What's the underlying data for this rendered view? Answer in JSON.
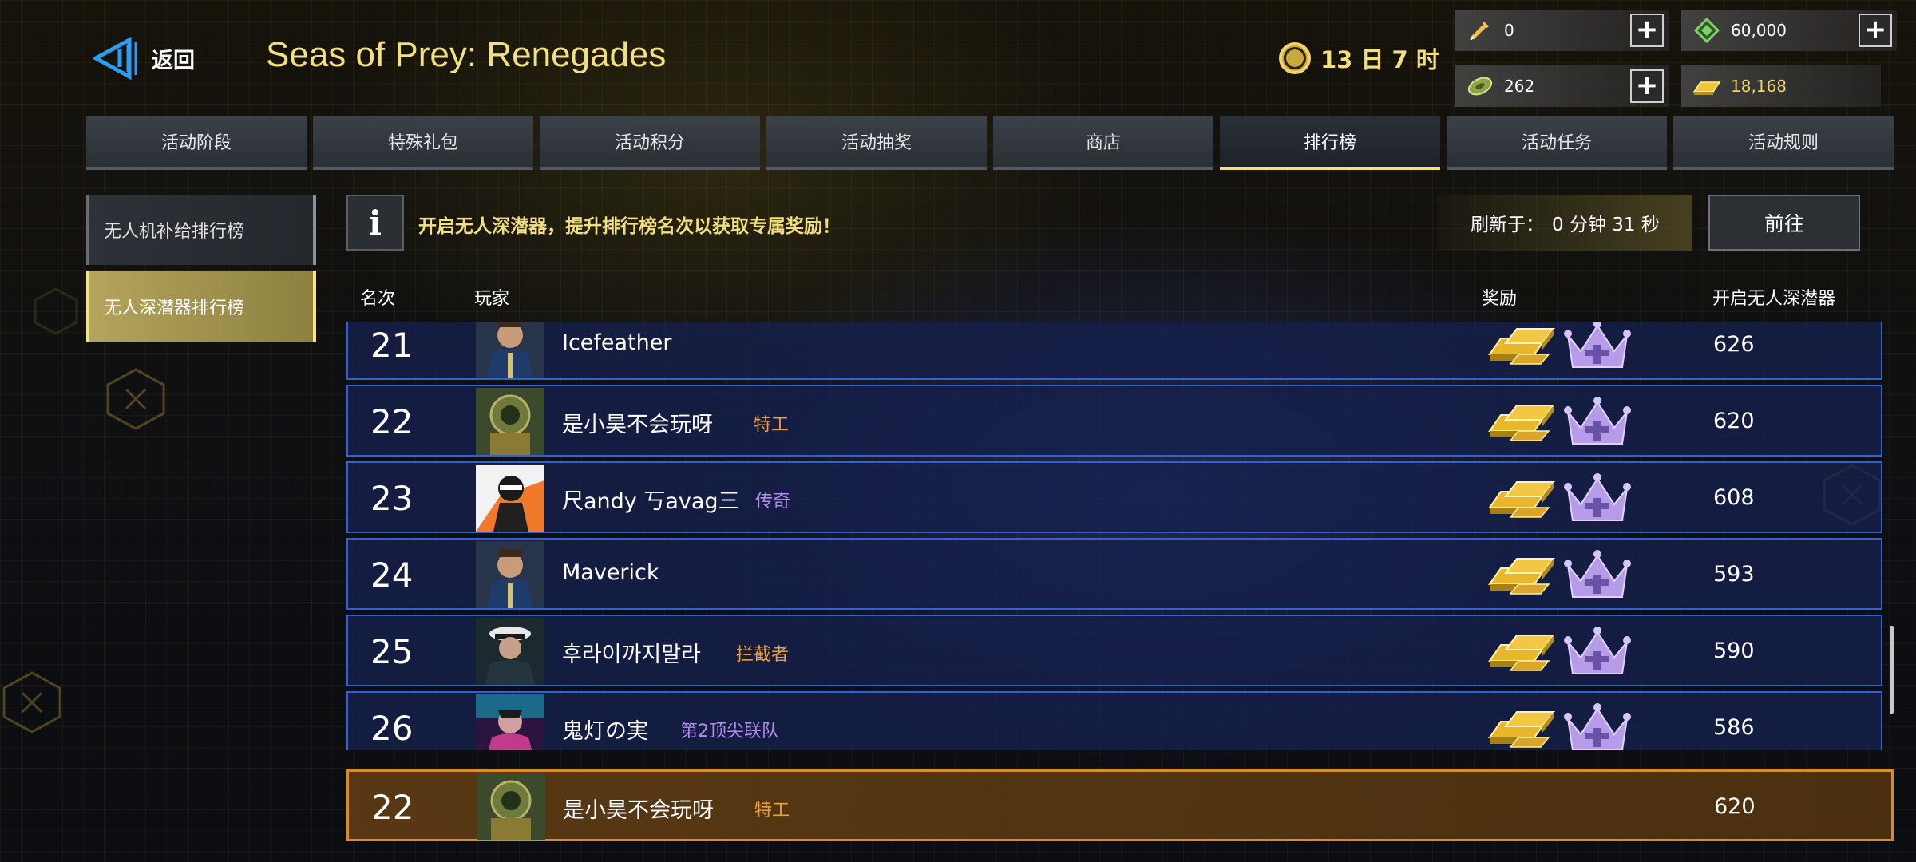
{
  "header": {
    "back_label": "返回",
    "title": "Seas of Prey: Renegades",
    "timer": "13 日 7 时"
  },
  "currencies": [
    {
      "name": "syringe-currency",
      "value": "0",
      "icon": "syringe-icon",
      "color": "#f0c04a"
    },
    {
      "name": "gem-currency",
      "value": "60,000",
      "icon": "green-gem-icon",
      "color": "#7fd06a"
    },
    {
      "name": "ticket-currency",
      "value": "262",
      "icon": "ticket-icon",
      "color": "#c4d86a"
    },
    {
      "name": "gold-currency",
      "value": "18,168",
      "icon": "gold-bar-icon",
      "color": "#f1c43a"
    }
  ],
  "tabs": [
    "活动阶段",
    "特殊礼包",
    "活动积分",
    "活动抽奖",
    "商店",
    "排行榜",
    "活动任务",
    "活动规则"
  ],
  "active_tab": "排行榜",
  "side_nav": [
    "无人机补给排行榜",
    "无人深潜器排行榜"
  ],
  "info": {
    "icon": "i",
    "text": "开启无人深潜器，提升排行榜名次以获取专属奖励！",
    "refresh_label": "刷新于：",
    "refresh_value": "0 分钟 31 秒",
    "goto_label": "前往"
  },
  "table": {
    "headers": {
      "rank": "名次",
      "player": "玩家",
      "reward": "奖励",
      "score": "开启无人深潜器"
    },
    "rows": [
      {
        "rank": "21",
        "name": "Icefeather",
        "title": "",
        "title_color": "",
        "score": "626",
        "avatar": "officer-avatar"
      },
      {
        "rank": "22",
        "name": "是小昊不会玩呀",
        "title": "特工",
        "title_color": "#e7a23c",
        "score": "620",
        "avatar": "diver-avatar"
      },
      {
        "rank": "23",
        "name": "尺andy 丂avag三",
        "title": "传奇",
        "title_color": "#b48cf0",
        "score": "608",
        "avatar": "ninja-avatar"
      },
      {
        "rank": "24",
        "name": "Maverick",
        "title": "",
        "title_color": "",
        "score": "593",
        "avatar": "officer-avatar"
      },
      {
        "rank": "25",
        "name": "후라이까지말라",
        "title": "拦截者",
        "title_color": "#e7a23c",
        "score": "590",
        "avatar": "captain-avatar"
      },
      {
        "rank": "26",
        "name": "鬼灯の実",
        "title": "第2顶尖联队",
        "title_color": "#b48cf0",
        "score": "586",
        "avatar": "cyberpunk-avatar"
      }
    ],
    "my_row": {
      "rank": "22",
      "name": "是小昊不会玩呀",
      "title": "特工",
      "score": "620",
      "avatar": "diver-avatar"
    }
  },
  "colors": {
    "accent_gold": "#f3df7e",
    "row_border": "#2f62d8",
    "my_row_border": "#e08a24",
    "crown": "#b59be8"
  }
}
